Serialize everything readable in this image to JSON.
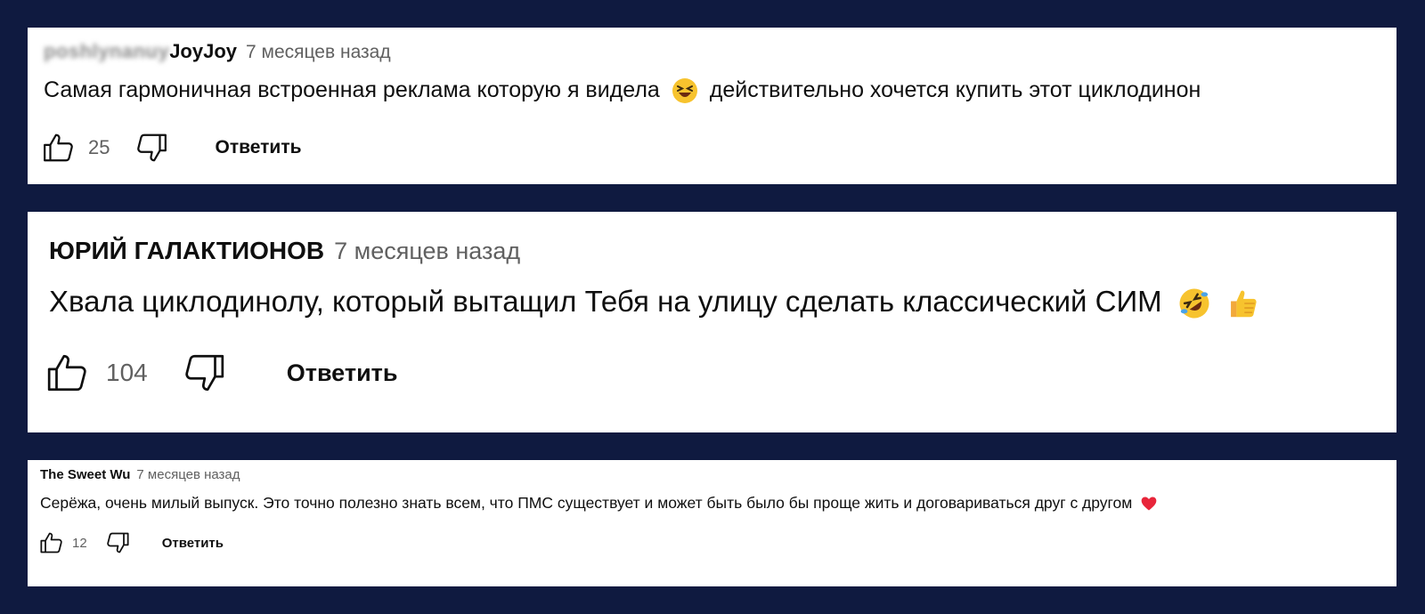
{
  "comments": [
    {
      "author_blurred": "poshlynanuy",
      "author": "JoyJoy",
      "time": "7 месяцев назад",
      "text": "Самая гармоничная встроенная реклама которую я видела",
      "text_after": "действительно хочется купить этот циклодинон",
      "emoji": "grinning-squinting-face",
      "likes": "25",
      "reply_label": "Ответить"
    },
    {
      "author": "ЮРИЙ ГАЛАКТИОНОВ",
      "time": "7 месяцев назад",
      "text": "Хвала циклодинолу, который вытащил Тебя на улицу сделать классический СИМ",
      "emojis": [
        "rolling-on-floor-laughing-face",
        "thumbs-up"
      ],
      "likes": "104",
      "reply_label": "Ответить"
    },
    {
      "author": "The Sweet Wu",
      "time": "7 месяцев назад",
      "text": "Серёжа, очень милый выпуск. Это точно полезно знать всем, что ПМС существует и может быть было бы проще жить и договариваться друг с другом",
      "emoji": "red-heart",
      "likes": "12",
      "reply_label": "Ответить"
    }
  ],
  "colors": {
    "background": "#0f1a40",
    "card": "#ffffff",
    "text": "#0f0f0f",
    "muted": "#606060"
  }
}
